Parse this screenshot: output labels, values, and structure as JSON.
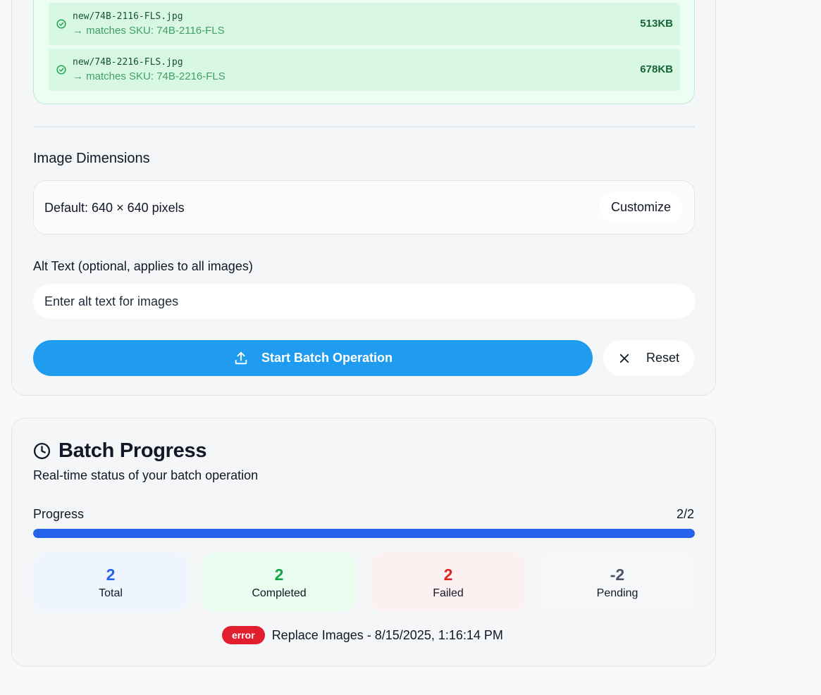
{
  "files": [
    {
      "name": "new/74B-2116-FLS.jpg",
      "match": "→ matches SKU: 74B-2116-FLS",
      "size": "513KB"
    },
    {
      "name": "new/74B-2216-FLS.jpg",
      "match": "→ matches SKU: 74B-2216-FLS",
      "size": "678KB"
    }
  ],
  "dimensions": {
    "title": "Image Dimensions",
    "default_text": "Default: 640 × 640 pixels",
    "customize_label": "Customize"
  },
  "alt_text": {
    "label": "Alt Text (optional, applies to all images)",
    "placeholder": "Enter alt text for images",
    "value": ""
  },
  "actions": {
    "start_label": "Start Batch Operation",
    "reset_label": "Reset"
  },
  "progress_card": {
    "title": "Batch Progress",
    "subtitle": "Real-time status of your batch operation",
    "progress_label": "Progress",
    "progress_count": "2/2",
    "progress_fraction": 1.0,
    "stats": {
      "total": {
        "value": "2",
        "label": "Total"
      },
      "completed": {
        "value": "2",
        "label": "Completed"
      },
      "failed": {
        "value": "2",
        "label": "Failed"
      },
      "pending": {
        "value": "-2",
        "label": "Pending"
      }
    },
    "log": {
      "badge": "error",
      "text": "Replace Images - 8/15/2025, 1:16:14 PM"
    }
  },
  "colors": {
    "primary_button": "#1f9bf0",
    "progress_fill": "#2563eb",
    "success": "#16a34a",
    "error": "#dc2626"
  },
  "icons": [
    "check-circle-icon",
    "upload-icon",
    "close-icon",
    "clock-icon"
  ]
}
